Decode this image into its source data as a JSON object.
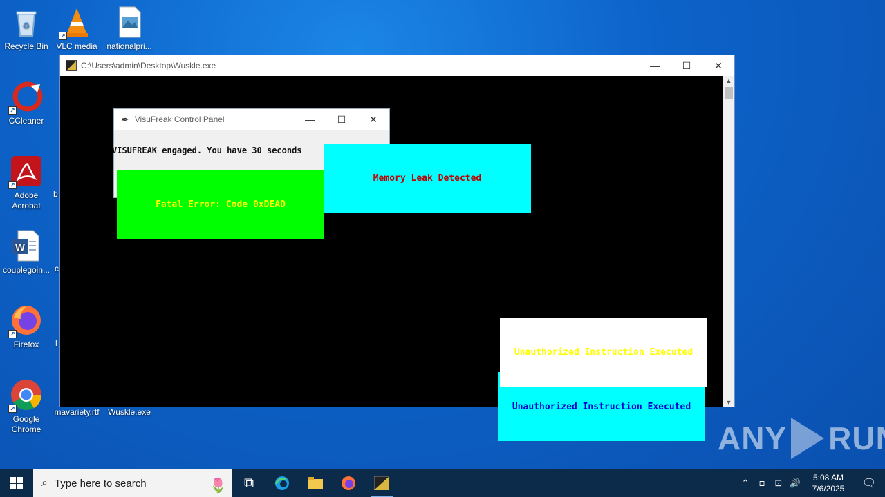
{
  "desktop_icons": [
    {
      "label": "Recycle Bin",
      "icon": "recycle-bin-icon"
    },
    {
      "label": "VLC media",
      "icon": "vlc-icon"
    },
    {
      "label": "nationalpri...",
      "icon": "image-file-icon"
    },
    {
      "label": "CCleaner",
      "icon": "ccleaner-icon"
    },
    {
      "label": "Adobe Acrobat",
      "icon": "acrobat-icon"
    },
    {
      "label": "couplegoin...",
      "icon": "word-doc-icon"
    },
    {
      "label": "Firefox",
      "icon": "firefox-icon"
    },
    {
      "label": "Google Chrome",
      "icon": "chrome-icon"
    },
    {
      "label": "mavariety.rtf",
      "icon": "rtf-file-icon"
    },
    {
      "label": "Wuskle.exe",
      "icon": "exe-file-icon"
    }
  ],
  "partial_labels": [
    "b",
    "c",
    "l"
  ],
  "console": {
    "title": "C:\\Users\\admin\\Desktop\\Wuskle.exe",
    "minimize": "—",
    "maximize": "☐",
    "close": "✕"
  },
  "control_panel": {
    "title": "VisuFreak Control Panel",
    "message": "VISUFREAK engaged. You have 30 seconds",
    "minimize": "—",
    "maximize": "☐",
    "close": "✕"
  },
  "popups": [
    {
      "text": "Fatal Error: Code 0xDEAD",
      "bg": "#00ff00",
      "fg": "#ffff00"
    },
    {
      "text": "Memory Leak Detected",
      "bg": "#00ffff",
      "fg": "#c00000"
    },
    {
      "text": "Unauthorized Instruction Executed",
      "bg": "#ffffff",
      "fg": "#ffff00"
    },
    {
      "text": "Unauthorized Instruction Executed",
      "bg": "#00ffff",
      "fg": "#0000cc"
    }
  ],
  "watermark": {
    "left": "ANY",
    "right": "RUN"
  },
  "taskbar": {
    "search_placeholder": "Type here to search",
    "time": "5:08 AM",
    "date": "7/6/2025"
  }
}
